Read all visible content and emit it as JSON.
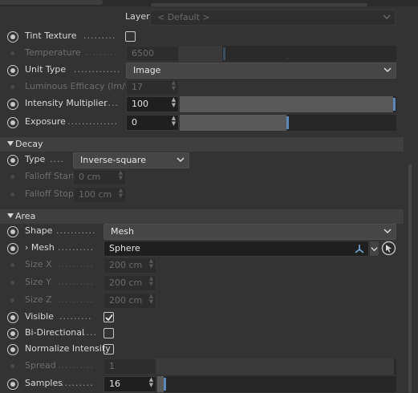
{
  "layer": {
    "label": "Layer",
    "value": "< Default >"
  },
  "general": {
    "tint_texture": {
      "label": "Tint Texture",
      "checked": false
    },
    "temperature": {
      "label": "Temperature",
      "value": "6500",
      "level": 0.2
    },
    "unit_type": {
      "label": "Unit Type",
      "value": "Image"
    },
    "luminous_efficacy": {
      "label": "Luminous Efficacy (lm/w)",
      "value": "17"
    },
    "intensity_multiplier": {
      "label": "Intensity Multiplier",
      "value": "100",
      "level": 1.0
    },
    "exposure": {
      "label": "Exposure",
      "value": "0",
      "level": 0.5
    }
  },
  "decay": {
    "title": "Decay",
    "type": {
      "label": "Type",
      "value": "Inverse-square"
    },
    "falloff_start": {
      "label": "Falloff Start",
      "value": "0 cm"
    },
    "falloff_stop": {
      "label": "Falloff Stop",
      "value": "100 cm"
    }
  },
  "area": {
    "title": "Area",
    "shape": {
      "label": "Shape",
      "value": "Mesh"
    },
    "mesh": {
      "label": "Mesh",
      "value": "Sphere"
    },
    "size_x": {
      "label": "Size X",
      "value": "200 cm"
    },
    "size_y": {
      "label": "Size Y",
      "value": "200 cm"
    },
    "size_z": {
      "label": "Size Z",
      "value": "200 cm"
    },
    "visible": {
      "label": "Visible",
      "checked": true
    },
    "bi_directional": {
      "label": "Bi-Directional",
      "checked": false
    },
    "normalize_intensity": {
      "label": "Normalize Intensity",
      "checked": false
    },
    "spread": {
      "label": "Spread",
      "value": "1",
      "level": 1.0
    },
    "samples": {
      "label": "Samples",
      "value": "16",
      "level": 0.02
    }
  },
  "colors": {
    "accent": "#5d88b8",
    "background": "#333333",
    "field": "#1f1f1f",
    "section": "#3f3f3f"
  },
  "icons": [
    "radio-dot-icon",
    "chevron-down-icon",
    "triangle-down-icon",
    "checkmark-icon",
    "axis-gizmo-icon",
    "pick-arrow-icon"
  ]
}
